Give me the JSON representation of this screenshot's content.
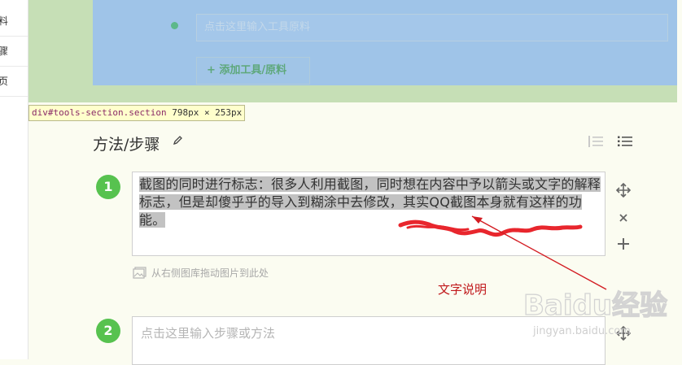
{
  "sidebar": {
    "items": [
      {
        "label": "料"
      },
      {
        "label": "骤"
      },
      {
        "label": "页"
      }
    ]
  },
  "tools": {
    "input_placeholder": "点击这里输入工具原料",
    "add_button_label": "+ 添加工具/原料",
    "close_glyph": "×"
  },
  "inspector_tooltip": {
    "selector": "div#tools-section.section",
    "dimensions": "798px × 253px"
  },
  "steps_section": {
    "title": "方法/步骤",
    "steps": [
      {
        "number": "1",
        "text_highlighted": "截图的同时进行标志：很多人利用截图，同时想在内容中予以箭头或文字的解释标志，但是却傻乎乎的导入到糊涂中去修改，其实QQ截图本身就有这样的功能。",
        "image_hint": "从右侧图库拖动图片到此处"
      },
      {
        "number": "2",
        "placeholder": "点击这里输入步骤或方法"
      }
    ]
  },
  "annotation": {
    "label": "文字说明"
  },
  "watermark": {
    "brand": "Baidu经验",
    "url": "jingyan.baidu.com"
  },
  "colors": {
    "step_green": "#57c24f",
    "overlay_blue": "#9fc4e8",
    "band_green": "#c6dfb6",
    "annotation_red": "#c0181b"
  }
}
